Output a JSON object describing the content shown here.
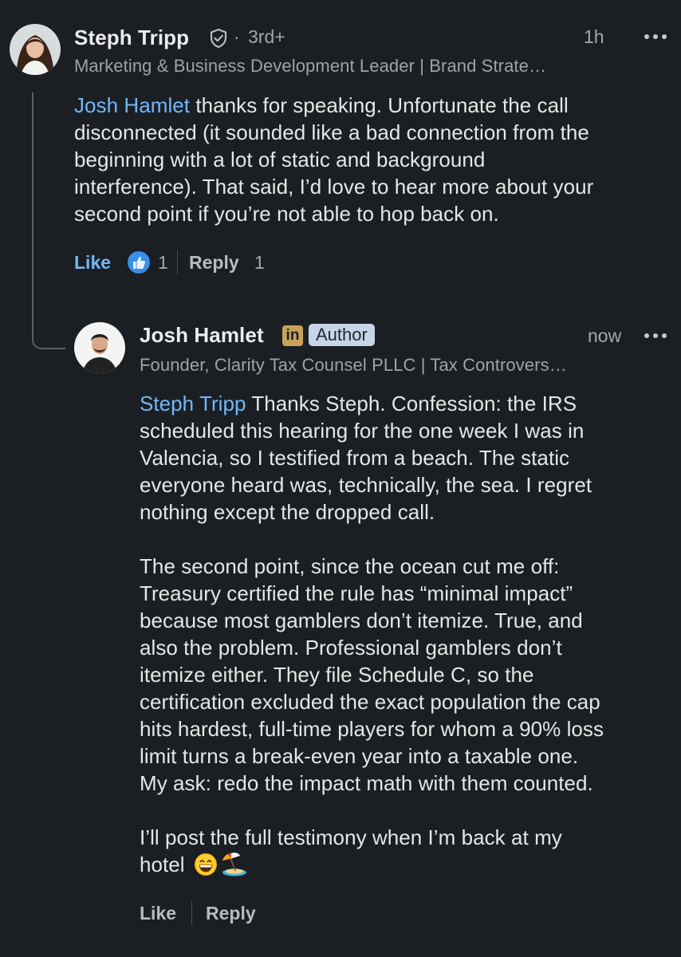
{
  "comment": {
    "author_name": "Steph Tripp",
    "connection": "3rd+",
    "time": "1h",
    "headline": "Marketing & Business Development Leader | Brand Strate…",
    "mention": "Josh Hamlet",
    "text_line1_rest": " thanks for speaking. Unfortunate the call",
    "text_line2": "disconnected (it sounded like a bad connection from the",
    "text_line3": "beginning with a lot of static and background",
    "text_line4": "interference). That said, I’d love to hear more about your",
    "text_line5": "second point if you’re not able to hop back on.",
    "like_label": "Like",
    "like_count": "1",
    "reply_label": "Reply",
    "reply_count": "1",
    "icons": [
      "verified-shield-icon",
      "like-reaction-icon",
      "more-options-icon"
    ],
    "accent_color": "#71b7fb"
  },
  "reply": {
    "author_name": "Josh Hamlet",
    "linkedin_badge": "in",
    "author_badge": "Author",
    "time": "now",
    "headline": "Founder, Clarity Tax Counsel PLLC | Tax Controvers…",
    "mention": "Steph Tripp",
    "p1_line1_rest": " Thanks Steph. Confession: the IRS",
    "p1_line2": "scheduled this hearing for the one week I was in",
    "p1_line3": "Valencia, so I testified from a beach. The static",
    "p1_line4": "everyone heard was, technically, the sea. I regret",
    "p1_line5": "nothing except the dropped call.",
    "p2_line1": "The second point, since the ocean cut me off:",
    "p2_line2": "Treasury certified the rule has “minimal impact”",
    "p2_line3": "because most gamblers don’t itemize. True, and",
    "p2_line4": "also the problem. Professional gamblers don’t",
    "p2_line5": "itemize either. They file Schedule C, so the",
    "p2_line6": "certification excluded the exact population the cap",
    "p2_line7": "hits hardest, full-time players for whom a 90% loss",
    "p2_line8": "limit turns a break-even year into a taxable one.",
    "p2_line9": "My ask: redo the impact math with them counted.",
    "p3_line1": "I’ll post the full testimony when I’m back at my",
    "p3_line2": "hotel",
    "like_label": "Like",
    "reply_label": "Reply",
    "icons": [
      "grinning-emoji-icon",
      "beach-umbrella-emoji-icon",
      "more-options-icon"
    ]
  }
}
